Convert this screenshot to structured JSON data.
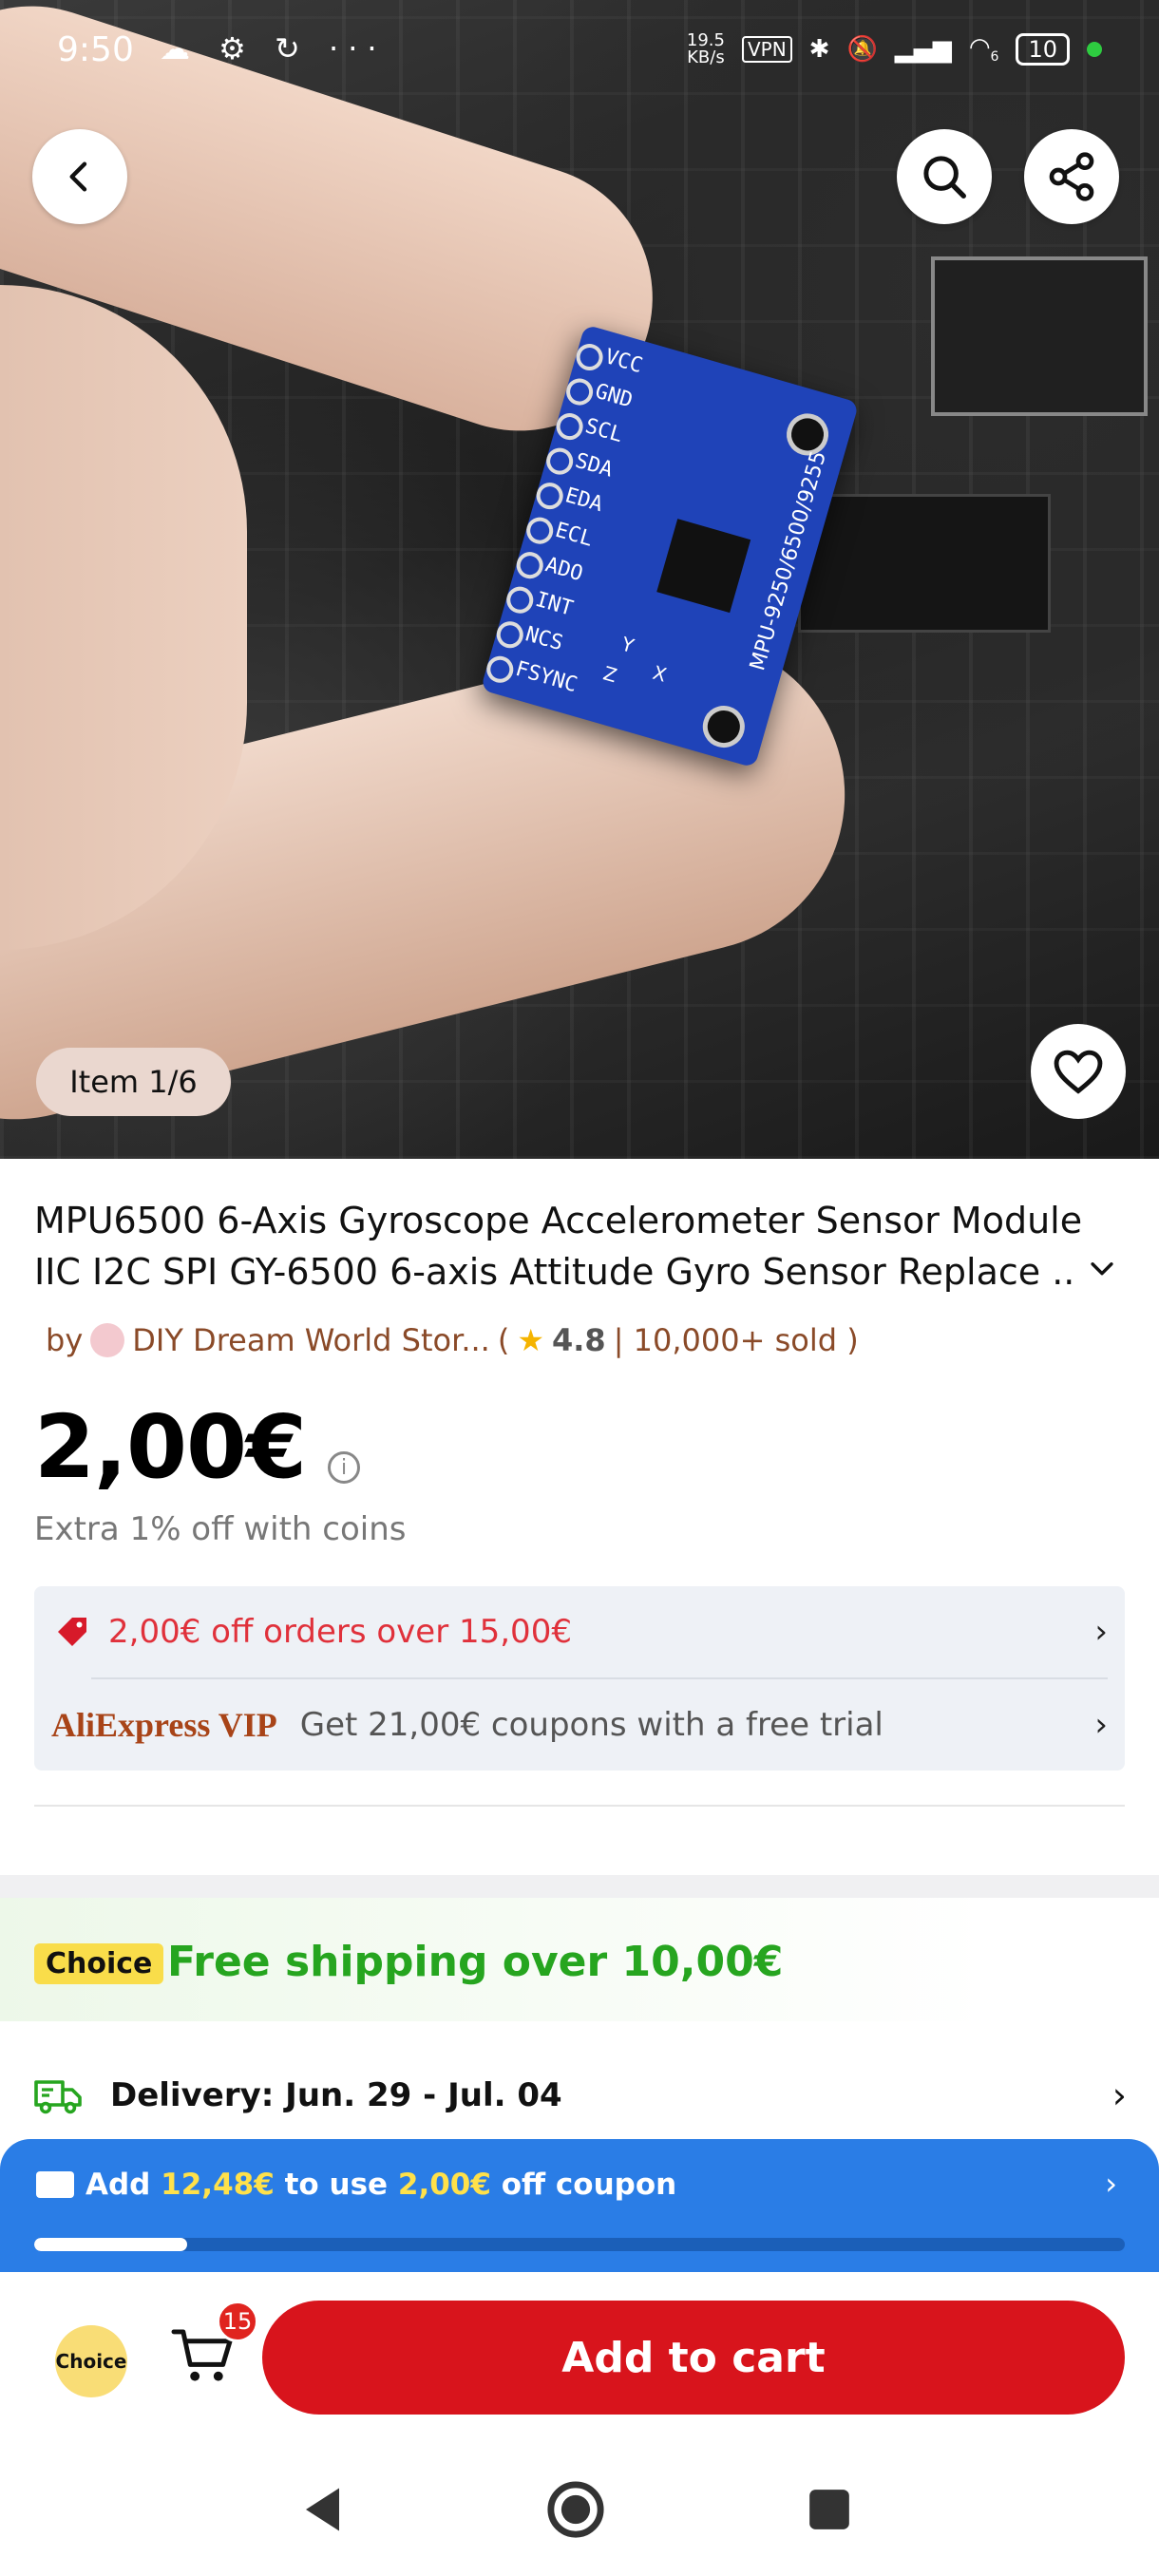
{
  "status_bar": {
    "time": "9:50",
    "left_icons": "☁ ⚙ ↻ ···",
    "net_speed_value": "19.5",
    "net_speed_unit": "KB/s",
    "vpn": "VPN",
    "battery": "10",
    "wifi_label": "6"
  },
  "gallery": {
    "item_counter": "Item 1/6",
    "image_alt": "MPU6500 blue sensor board held between fingers over a circuit board",
    "board_pins": [
      "VCC",
      "GND",
      "SCL",
      "SDA",
      "EDA",
      "ECL",
      "ADO",
      "INT",
      "NCS",
      "FSYNC"
    ],
    "board_model": "MPU-9250/6500/9255",
    "axis_labels": [
      "Y",
      "Z",
      "X"
    ]
  },
  "product": {
    "title_line1": "MPU6500 6-Axis Gyroscope Accelerometer Sensor Module",
    "title_line2": "IIC I2C SPI GY-6500 6-axis Attitude Gyro Sensor Replace ..",
    "by": "by",
    "store_name": "DIY Dream World Stor...",
    "paren_open": "(",
    "rating": "4.8",
    "sold": "| 10,000+ sold )",
    "price": "2,00€",
    "coins_text": "Extra 1% off with coins"
  },
  "promos": {
    "discount_text": "2,00€ off orders over 15,00€",
    "vip_brand": "AliExpress VIP",
    "vip_text": "Get 21,00€ coupons with a free trial"
  },
  "shipping": {
    "choice_tag": "Choice",
    "free_shipping": "Free shipping over 10,00€",
    "delivery": "Delivery: Jun. 29 - Jul. 04"
  },
  "coupon_bar": {
    "add": "Add",
    "amount": "12,48€",
    "to_use": "to use",
    "coupon_value": "2,00€",
    "off_coupon": "off coupon",
    "progress_fraction": 0.14
  },
  "bottom_bar": {
    "choice_label": "Choice",
    "cart_count": "15",
    "add_to_cart": "Add to cart"
  },
  "colors": {
    "accent_red": "#d8141c",
    "discount_red": "#e0313b",
    "choice_green": "#26a51f",
    "coupon_blue": "#2a7de6",
    "highlight_yellow": "#ffe14a",
    "store_brown": "#8a4a28"
  }
}
